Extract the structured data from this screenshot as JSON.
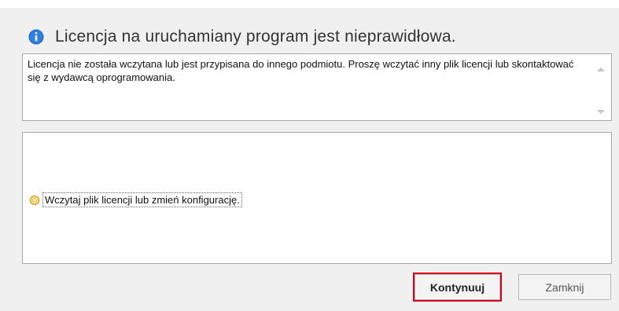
{
  "dialog": {
    "title": "Licencja na uruchamiany program jest nieprawidłowa.",
    "message": "Licencja nie została wczytana lub jest przypisana do innego podmiotu. Proszę wczytać inny plik licencji lub skontaktować się z wydawcą oprogramowania.",
    "option_label": "Wczytaj plik licencji lub zmień konfigurację.",
    "continue_label": "Kontynuuj",
    "close_label": "Zamknij"
  },
  "colors": {
    "info_icon": "#2f7fe0",
    "radio_selected": "#f3b11a",
    "highlight_border": "#d6001c"
  },
  "icons": {
    "info": "info-icon"
  }
}
